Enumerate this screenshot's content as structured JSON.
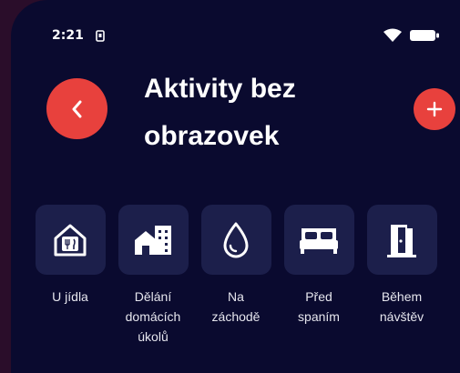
{
  "status_bar": {
    "time": "2:21",
    "sim_icon": "sim-card-icon",
    "wifi_icon": "wifi-icon",
    "battery_icon": "battery-icon"
  },
  "header": {
    "title": "Aktivity bez obrazovek",
    "back_icon": "chevron-left-icon",
    "add_icon": "plus-icon"
  },
  "categories": [
    {
      "label": "U jídla",
      "icon": "house-cutlery-icon"
    },
    {
      "label": "Dělání\ndomácích\núkolů",
      "icon": "buildings-icon"
    },
    {
      "label": "Na\nzáchodě",
      "icon": "water-drop-icon"
    },
    {
      "label": "Před\nspaním",
      "icon": "bed-icon"
    },
    {
      "label": "Během\nnávštěv",
      "icon": "door-icon"
    }
  ],
  "colors": {
    "background": "#0a0a2f",
    "accent": "#e8413d",
    "tile": "#1c1f4b",
    "outer": "#2a0d2a"
  }
}
